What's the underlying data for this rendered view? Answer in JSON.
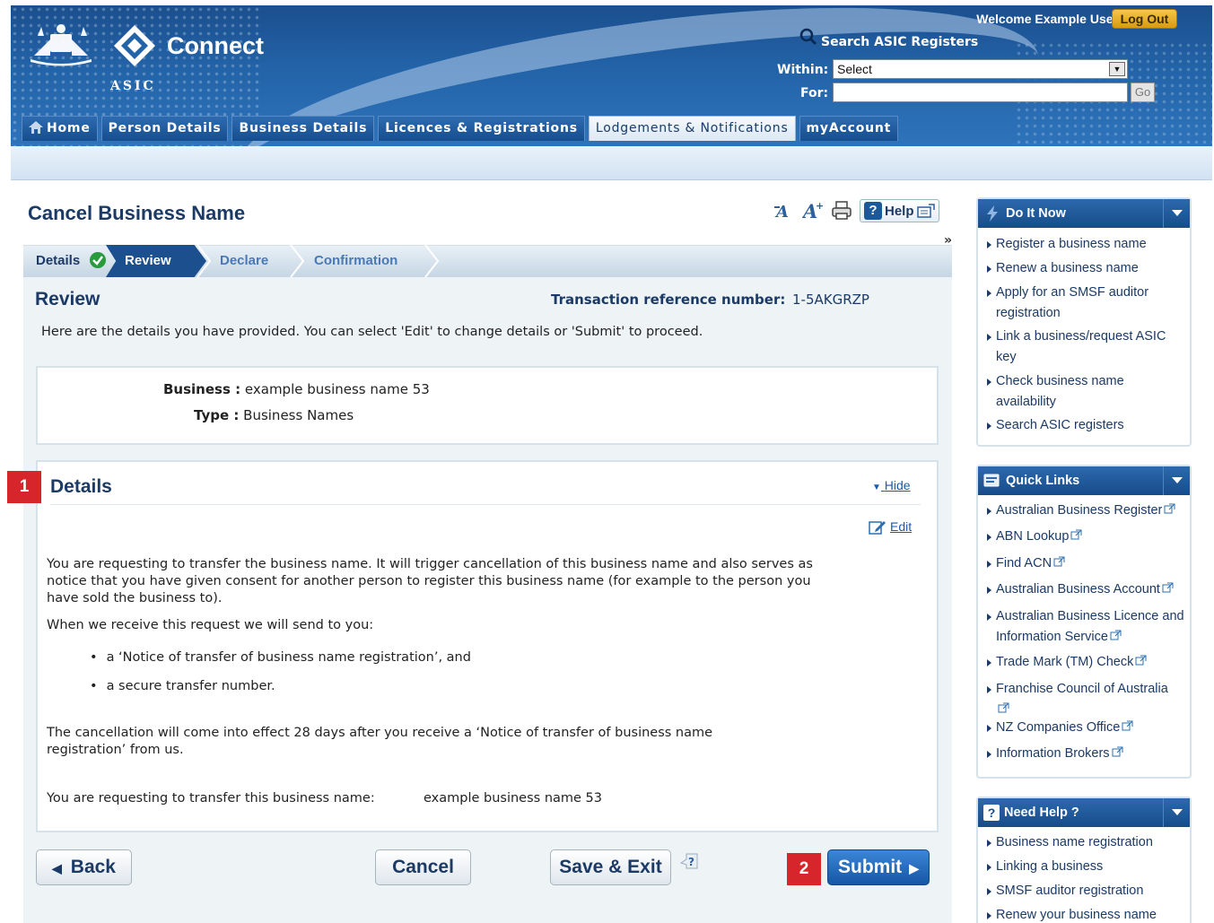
{
  "header": {
    "app_title": "Connect",
    "agency": "ASIC",
    "welcome": "Welcome Example User",
    "logout_label": "Log Out",
    "search_title": "Search ASIC Registers",
    "within_label": "Within:",
    "within_value": "Select",
    "for_label": "For:",
    "for_value": "",
    "go_label": "Go"
  },
  "tabs": [
    {
      "label": "Home"
    },
    {
      "label": "Person Details"
    },
    {
      "label": "Business Details"
    },
    {
      "label": "Licences & Registrations"
    },
    {
      "label": "Lodgements & Notifications"
    },
    {
      "label": "myAccount"
    }
  ],
  "page": {
    "title": "Cancel Business Name",
    "help_label": "Help",
    "more": "»"
  },
  "steps": [
    "Details",
    "Review",
    "Declare",
    "Confirmation"
  ],
  "review": {
    "heading": "Review",
    "trn_label": "Transaction reference number:",
    "trn_value": "1-5AKGRZP",
    "intro": "Here are the details you have provided. You can select 'Edit' to change details or 'Submit' to proceed."
  },
  "summary": {
    "business_label": "Business :",
    "business_value": "example business name 53",
    "type_label": "Type :",
    "type_value": "Business Names"
  },
  "details": {
    "heading": "Details",
    "hide_label": "Hide",
    "edit_label": "Edit",
    "para1": "You are requesting to  transfer the business name. It will trigger cancellation of this business name and also serves as notice that you have given consent for another person to register this business name (for example to the person you have sold the business to).",
    "para2": "When we receive this request we will send to you:",
    "bullets": [
      "a ‘Notice of transfer of business name registration’, and",
      "a secure transfer number."
    ],
    "para3": "The cancellation will come into effect 28 days after you receive a ‘Notice of transfer of business name registration’ from us.",
    "transfer_label": "You are requesting to transfer this business name:",
    "transfer_value": "example business name 53"
  },
  "buttons": {
    "back": "Back",
    "cancel": "Cancel",
    "save_exit": "Save & Exit",
    "submit": "Submit"
  },
  "markers": [
    "1",
    "2"
  ],
  "sidebar": {
    "do_it_now": {
      "title": "Do It Now",
      "items": [
        "Register a business name",
        "Renew a business name",
        "Apply for an SMSF auditor registration",
        "Link a business/request ASIC key",
        "Check business name availability",
        "Search ASIC registers"
      ]
    },
    "quick_links": {
      "title": "Quick Links",
      "items": [
        "Australian Business Register",
        "ABN Lookup",
        "Find ACN",
        "Australian Business Account",
        "Australian Business Licence and Information Service",
        "Trade Mark (TM) Check",
        "Franchise Council of Australia",
        "NZ Companies Office",
        "Information Brokers"
      ]
    },
    "need_help": {
      "title": "Need Help ?",
      "items": [
        "Business name registration",
        "Linking a business",
        "SMSF auditor registration",
        "Renew your business name"
      ]
    }
  },
  "colors": {
    "brand_blue": "#1b4f8e",
    "heading": "#1b3a66",
    "marker_red": "#d7262b",
    "logout_gold": "#e6ac20"
  }
}
